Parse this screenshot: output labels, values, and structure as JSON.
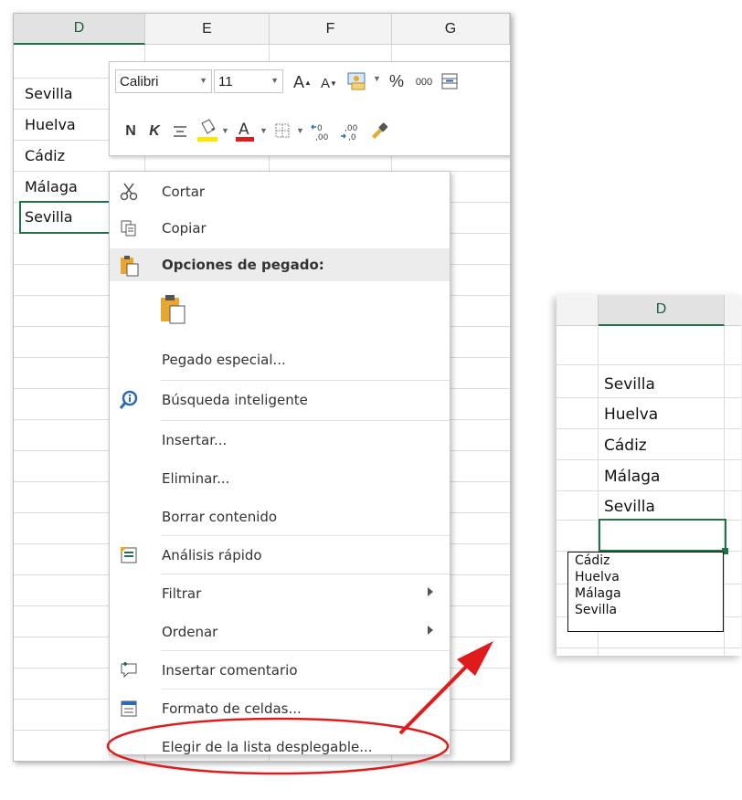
{
  "left_sheet": {
    "columns": [
      "D",
      "E",
      "F",
      "G"
    ],
    "cells": [
      "Sevilla",
      "Huelva",
      "Cádiz",
      "Málaga",
      "Sevilla"
    ]
  },
  "mini_toolbar": {
    "font_name": "Calibri",
    "font_size": "11",
    "bold": "N",
    "italic": "K",
    "percent": "%",
    "thousands": "000"
  },
  "context_menu": {
    "cut": "Cortar",
    "copy": "Copiar",
    "paste_options": "Opciones de pegado:",
    "paste_special": "Pegado especial...",
    "smart_lookup": "Búsqueda inteligente",
    "insert": "Insertar...",
    "delete": "Eliminar...",
    "clear_contents": "Borrar contenido",
    "quick_analysis": "Análisis rápido",
    "filter": "Filtrar",
    "sort": "Ordenar",
    "insert_comment": "Insertar comentario",
    "format_cells": "Formato de celdas...",
    "pick_from_list": "Elegir de la lista desplegable..."
  },
  "right_sheet": {
    "column": "D",
    "cells": [
      "Sevilla",
      "Huelva",
      "Cádiz",
      "Málaga",
      "Sevilla"
    ],
    "dropdown_options": [
      "Cádiz",
      "Huelva",
      "Málaga",
      "Sevilla"
    ]
  },
  "colors": {
    "excel_green": "#217346",
    "annotation_red": "#e01b1b"
  }
}
